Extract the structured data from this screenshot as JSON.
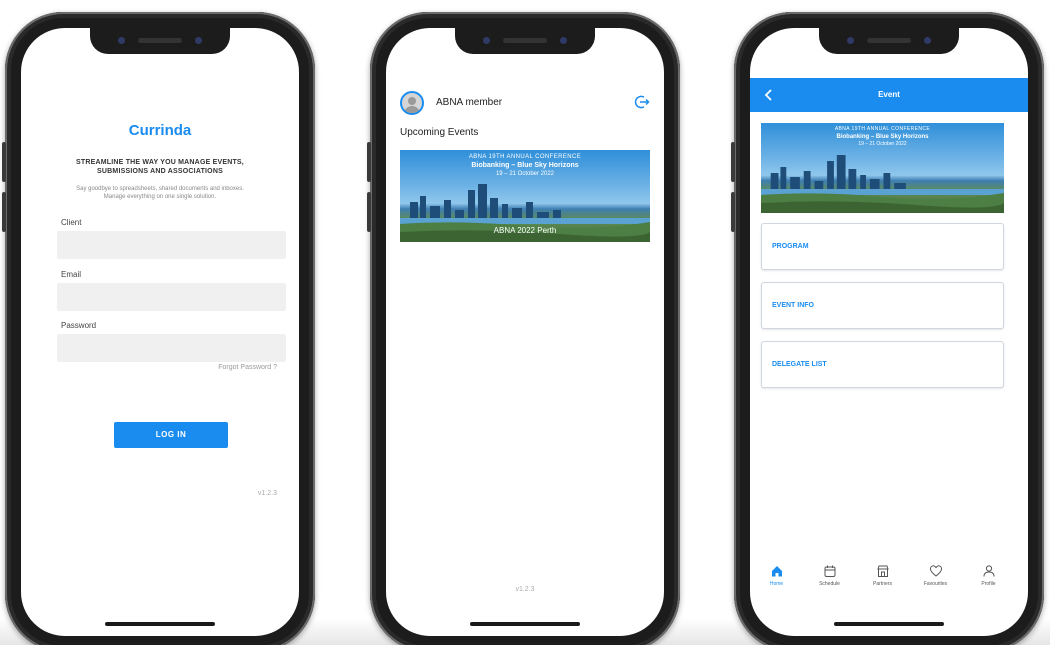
{
  "login_screen": {
    "brand": "Currinda",
    "tagline": "STREAMLINE THE WAY YOU MANAGE EVENTS, SUBMISSIONS AND ASSOCIATIONS",
    "subtagline": "Say goodbye to spreadsheets, shared documents and inboxes. Manage everything on one single solution.",
    "client_label": "Client",
    "client_value": "",
    "email_label": "Email",
    "email_value": "",
    "password_label": "Password",
    "password_value": "",
    "forgot_password": "Forgot Password ?",
    "login_button": "LOG IN",
    "version": "v1.2.3"
  },
  "events_screen": {
    "member_name": "ABNA member",
    "section_title": "Upcoming Events",
    "event": {
      "conference": "ABNA 19TH ANNUAL CONFERENCE",
      "theme": "Biobanking – Blue Sky Horizons",
      "dates": "19 – 21 October 2022",
      "caption": "ABNA 2022 Perth"
    },
    "version": "v1.2.3"
  },
  "event_screen": {
    "header_title": "Event",
    "banner": {
      "conference": "ABNA 19TH ANNUAL CONFERENCE",
      "theme": "Biobanking – Blue Sky Horizons",
      "dates": "19 – 21 October 2022"
    },
    "menu": [
      {
        "label": "PROGRAM"
      },
      {
        "label": "EVENT INFO"
      },
      {
        "label": "DELEGATE LIST"
      }
    ],
    "tabs": [
      {
        "label": "Home",
        "icon": "home-icon",
        "active": true
      },
      {
        "label": "Schedule",
        "icon": "calendar-icon",
        "active": false
      },
      {
        "label": "Partners",
        "icon": "store-icon",
        "active": false
      },
      {
        "label": "Favourites",
        "icon": "heart-icon",
        "active": false
      },
      {
        "label": "Profile",
        "icon": "user-icon",
        "active": false
      }
    ]
  },
  "colors": {
    "accent": "#1a8cf0",
    "field_bg": "#f0f0f0",
    "phone_frame": "#1c1c1c"
  }
}
